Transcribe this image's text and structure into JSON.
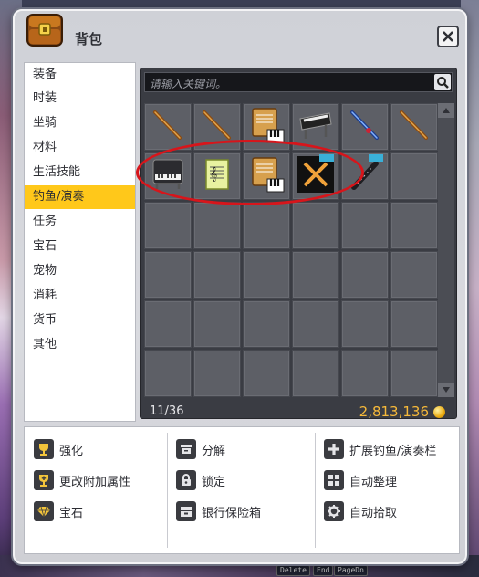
{
  "window": {
    "title": "背包",
    "close_icon": "close-icon",
    "title_icon": "backpack-chest-icon"
  },
  "categories": [
    {
      "label": "装备"
    },
    {
      "label": "时装"
    },
    {
      "label": "坐骑"
    },
    {
      "label": "材料"
    },
    {
      "label": "生活技能"
    },
    {
      "label": "钓鱼/演奏",
      "active": true
    },
    {
      "label": "任务"
    },
    {
      "label": "宝石"
    },
    {
      "label": "宠物"
    },
    {
      "label": "消耗"
    },
    {
      "label": "货币"
    },
    {
      "label": "其他"
    }
  ],
  "search": {
    "placeholder": "请输入关键词。"
  },
  "inventory": {
    "count": "11/36",
    "gold": "2,813,136",
    "items": [
      "fishing-rod-icon",
      "fishing-rod-icon",
      "sheet-music-piano-icon",
      "keyboard-instrument-icon",
      "blue-fishing-rod-icon",
      "fishing-rod-icon",
      "piano-icon",
      "sheet-music-icon",
      "sheet-music-piano-icon",
      "locked-instrument-icon",
      "clarinet-icon",
      "",
      "",
      "",
      "",
      "",
      "",
      "",
      "",
      "",
      "",
      "",
      "",
      "",
      "",
      "",
      "",
      "",
      "",
      "",
      "",
      "",
      "",
      "",
      "",
      ""
    ]
  },
  "actions": [
    {
      "label": "强化",
      "icon": "trophy-icon"
    },
    {
      "label": "更改附加属性",
      "icon": "trophy-plus-icon"
    },
    {
      "label": "宝石",
      "icon": "gem-icon"
    },
    {
      "label": "分解",
      "icon": "disassemble-icon"
    },
    {
      "label": "锁定",
      "icon": "lock-icon"
    },
    {
      "label": "银行保险箱",
      "icon": "bank-safe-icon"
    },
    {
      "label": "扩展钓鱼/演奏栏",
      "icon": "plus-icon"
    },
    {
      "label": "自动整理",
      "icon": "grid-sort-icon"
    },
    {
      "label": "自动拾取",
      "icon": "gear-icon"
    }
  ],
  "hotkeys": [
    "Delete",
    "End",
    "PageDn"
  ],
  "colors": {
    "accent": "#ffc81a",
    "gold": "#f6b93a",
    "annotation": "#d7151b"
  }
}
